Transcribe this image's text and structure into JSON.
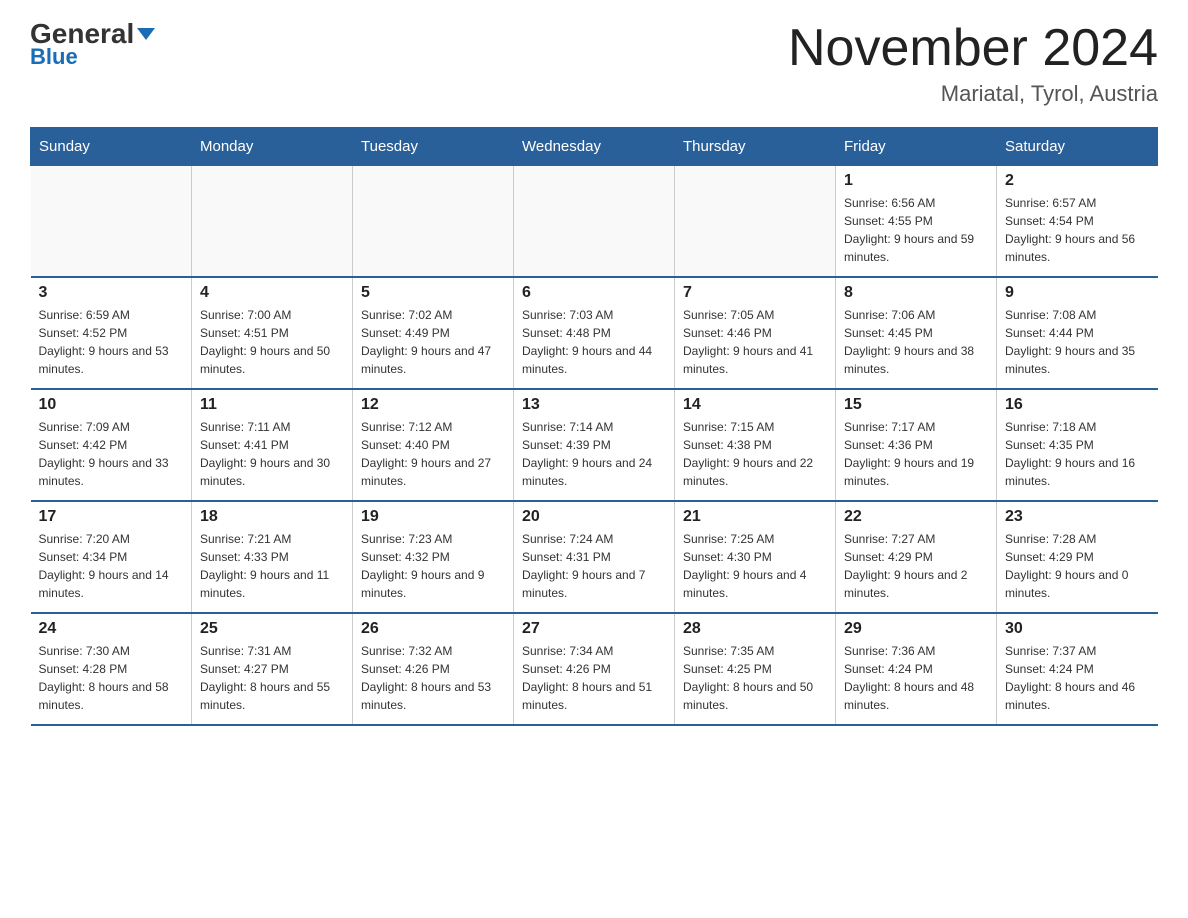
{
  "header": {
    "logo_general": "General",
    "logo_blue": "Blue",
    "month_title": "November 2024",
    "location": "Mariatal, Tyrol, Austria"
  },
  "days_of_week": [
    "Sunday",
    "Monday",
    "Tuesday",
    "Wednesday",
    "Thursday",
    "Friday",
    "Saturday"
  ],
  "weeks": [
    [
      {
        "day": "",
        "info": ""
      },
      {
        "day": "",
        "info": ""
      },
      {
        "day": "",
        "info": ""
      },
      {
        "day": "",
        "info": ""
      },
      {
        "day": "",
        "info": ""
      },
      {
        "day": "1",
        "info": "Sunrise: 6:56 AM\nSunset: 4:55 PM\nDaylight: 9 hours and 59 minutes."
      },
      {
        "day": "2",
        "info": "Sunrise: 6:57 AM\nSunset: 4:54 PM\nDaylight: 9 hours and 56 minutes."
      }
    ],
    [
      {
        "day": "3",
        "info": "Sunrise: 6:59 AM\nSunset: 4:52 PM\nDaylight: 9 hours and 53 minutes."
      },
      {
        "day": "4",
        "info": "Sunrise: 7:00 AM\nSunset: 4:51 PM\nDaylight: 9 hours and 50 minutes."
      },
      {
        "day": "5",
        "info": "Sunrise: 7:02 AM\nSunset: 4:49 PM\nDaylight: 9 hours and 47 minutes."
      },
      {
        "day": "6",
        "info": "Sunrise: 7:03 AM\nSunset: 4:48 PM\nDaylight: 9 hours and 44 minutes."
      },
      {
        "day": "7",
        "info": "Sunrise: 7:05 AM\nSunset: 4:46 PM\nDaylight: 9 hours and 41 minutes."
      },
      {
        "day": "8",
        "info": "Sunrise: 7:06 AM\nSunset: 4:45 PM\nDaylight: 9 hours and 38 minutes."
      },
      {
        "day": "9",
        "info": "Sunrise: 7:08 AM\nSunset: 4:44 PM\nDaylight: 9 hours and 35 minutes."
      }
    ],
    [
      {
        "day": "10",
        "info": "Sunrise: 7:09 AM\nSunset: 4:42 PM\nDaylight: 9 hours and 33 minutes."
      },
      {
        "day": "11",
        "info": "Sunrise: 7:11 AM\nSunset: 4:41 PM\nDaylight: 9 hours and 30 minutes."
      },
      {
        "day": "12",
        "info": "Sunrise: 7:12 AM\nSunset: 4:40 PM\nDaylight: 9 hours and 27 minutes."
      },
      {
        "day": "13",
        "info": "Sunrise: 7:14 AM\nSunset: 4:39 PM\nDaylight: 9 hours and 24 minutes."
      },
      {
        "day": "14",
        "info": "Sunrise: 7:15 AM\nSunset: 4:38 PM\nDaylight: 9 hours and 22 minutes."
      },
      {
        "day": "15",
        "info": "Sunrise: 7:17 AM\nSunset: 4:36 PM\nDaylight: 9 hours and 19 minutes."
      },
      {
        "day": "16",
        "info": "Sunrise: 7:18 AM\nSunset: 4:35 PM\nDaylight: 9 hours and 16 minutes."
      }
    ],
    [
      {
        "day": "17",
        "info": "Sunrise: 7:20 AM\nSunset: 4:34 PM\nDaylight: 9 hours and 14 minutes."
      },
      {
        "day": "18",
        "info": "Sunrise: 7:21 AM\nSunset: 4:33 PM\nDaylight: 9 hours and 11 minutes."
      },
      {
        "day": "19",
        "info": "Sunrise: 7:23 AM\nSunset: 4:32 PM\nDaylight: 9 hours and 9 minutes."
      },
      {
        "day": "20",
        "info": "Sunrise: 7:24 AM\nSunset: 4:31 PM\nDaylight: 9 hours and 7 minutes."
      },
      {
        "day": "21",
        "info": "Sunrise: 7:25 AM\nSunset: 4:30 PM\nDaylight: 9 hours and 4 minutes."
      },
      {
        "day": "22",
        "info": "Sunrise: 7:27 AM\nSunset: 4:29 PM\nDaylight: 9 hours and 2 minutes."
      },
      {
        "day": "23",
        "info": "Sunrise: 7:28 AM\nSunset: 4:29 PM\nDaylight: 9 hours and 0 minutes."
      }
    ],
    [
      {
        "day": "24",
        "info": "Sunrise: 7:30 AM\nSunset: 4:28 PM\nDaylight: 8 hours and 58 minutes."
      },
      {
        "day": "25",
        "info": "Sunrise: 7:31 AM\nSunset: 4:27 PM\nDaylight: 8 hours and 55 minutes."
      },
      {
        "day": "26",
        "info": "Sunrise: 7:32 AM\nSunset: 4:26 PM\nDaylight: 8 hours and 53 minutes."
      },
      {
        "day": "27",
        "info": "Sunrise: 7:34 AM\nSunset: 4:26 PM\nDaylight: 8 hours and 51 minutes."
      },
      {
        "day": "28",
        "info": "Sunrise: 7:35 AM\nSunset: 4:25 PM\nDaylight: 8 hours and 50 minutes."
      },
      {
        "day": "29",
        "info": "Sunrise: 7:36 AM\nSunset: 4:24 PM\nDaylight: 8 hours and 48 minutes."
      },
      {
        "day": "30",
        "info": "Sunrise: 7:37 AM\nSunset: 4:24 PM\nDaylight: 8 hours and 46 minutes."
      }
    ]
  ]
}
